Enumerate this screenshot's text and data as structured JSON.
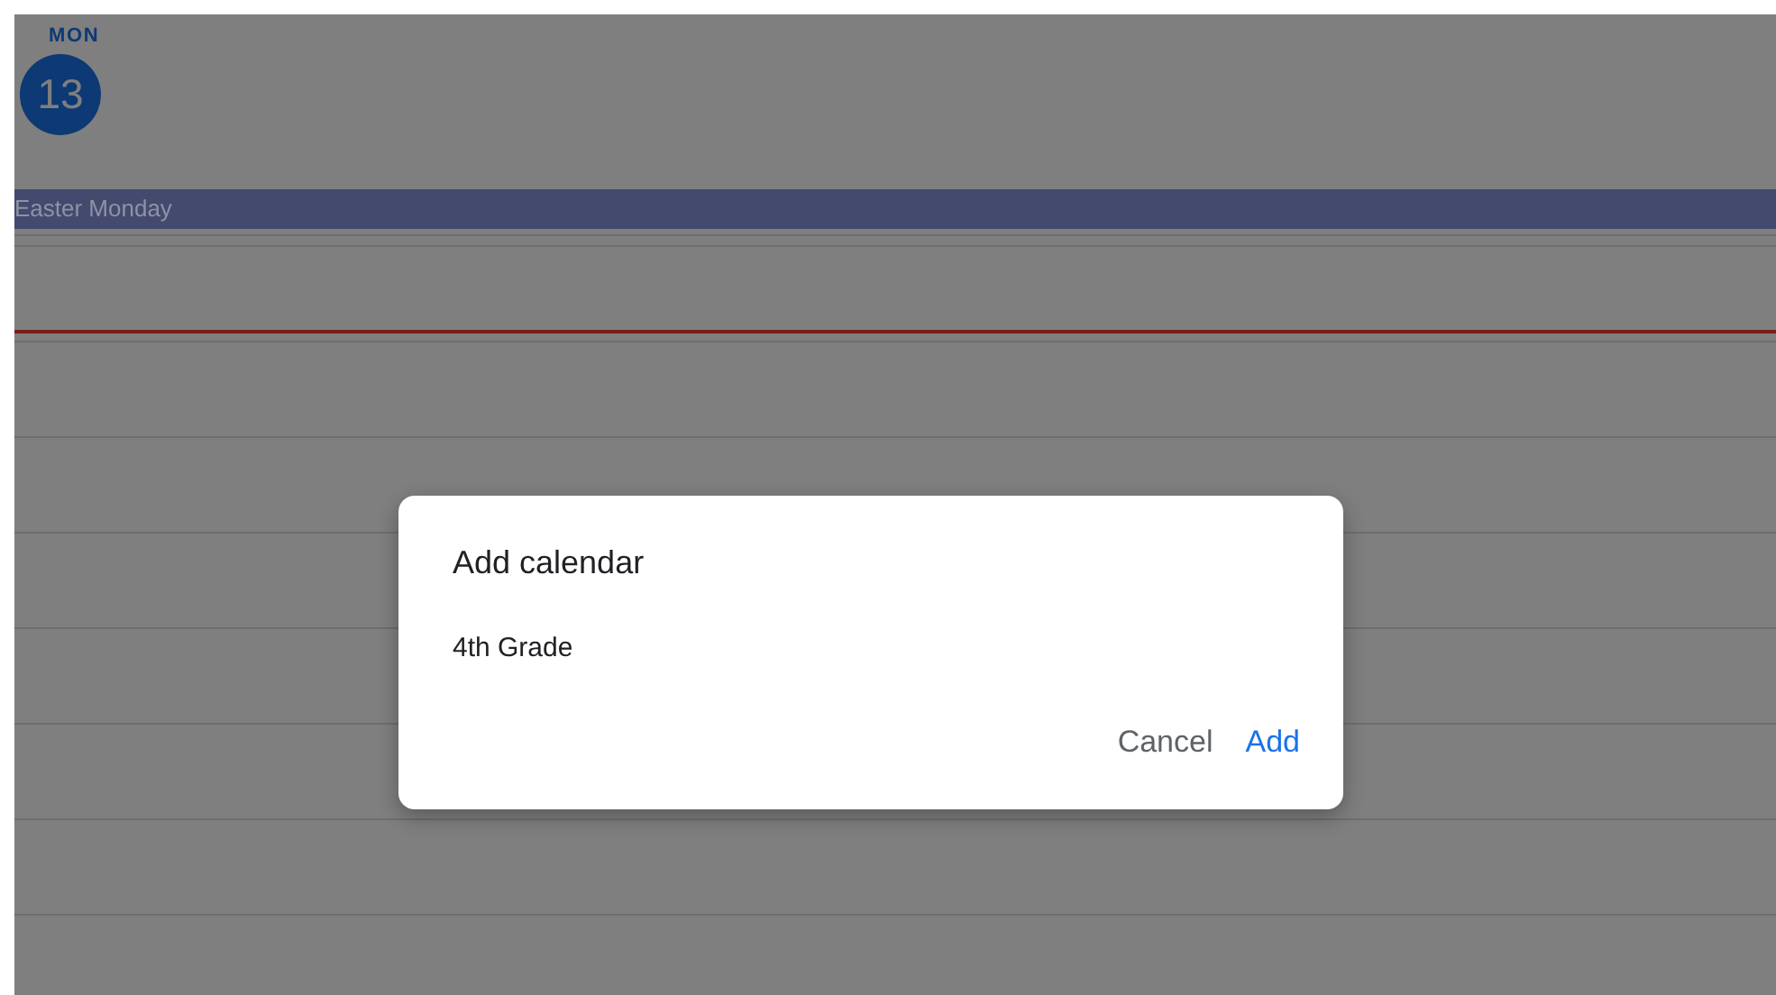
{
  "day_header": {
    "weekday": "MON",
    "date": "13",
    "today": true
  },
  "all_day_events": [
    {
      "title": "Easter Monday",
      "color": "#434a6e"
    }
  ],
  "dialog": {
    "title": "Add calendar",
    "calendar_name": "4th Grade",
    "buttons": [
      {
        "label": "Cancel",
        "kind": "secondary"
      },
      {
        "label": "Add",
        "kind": "primary"
      }
    ]
  }
}
